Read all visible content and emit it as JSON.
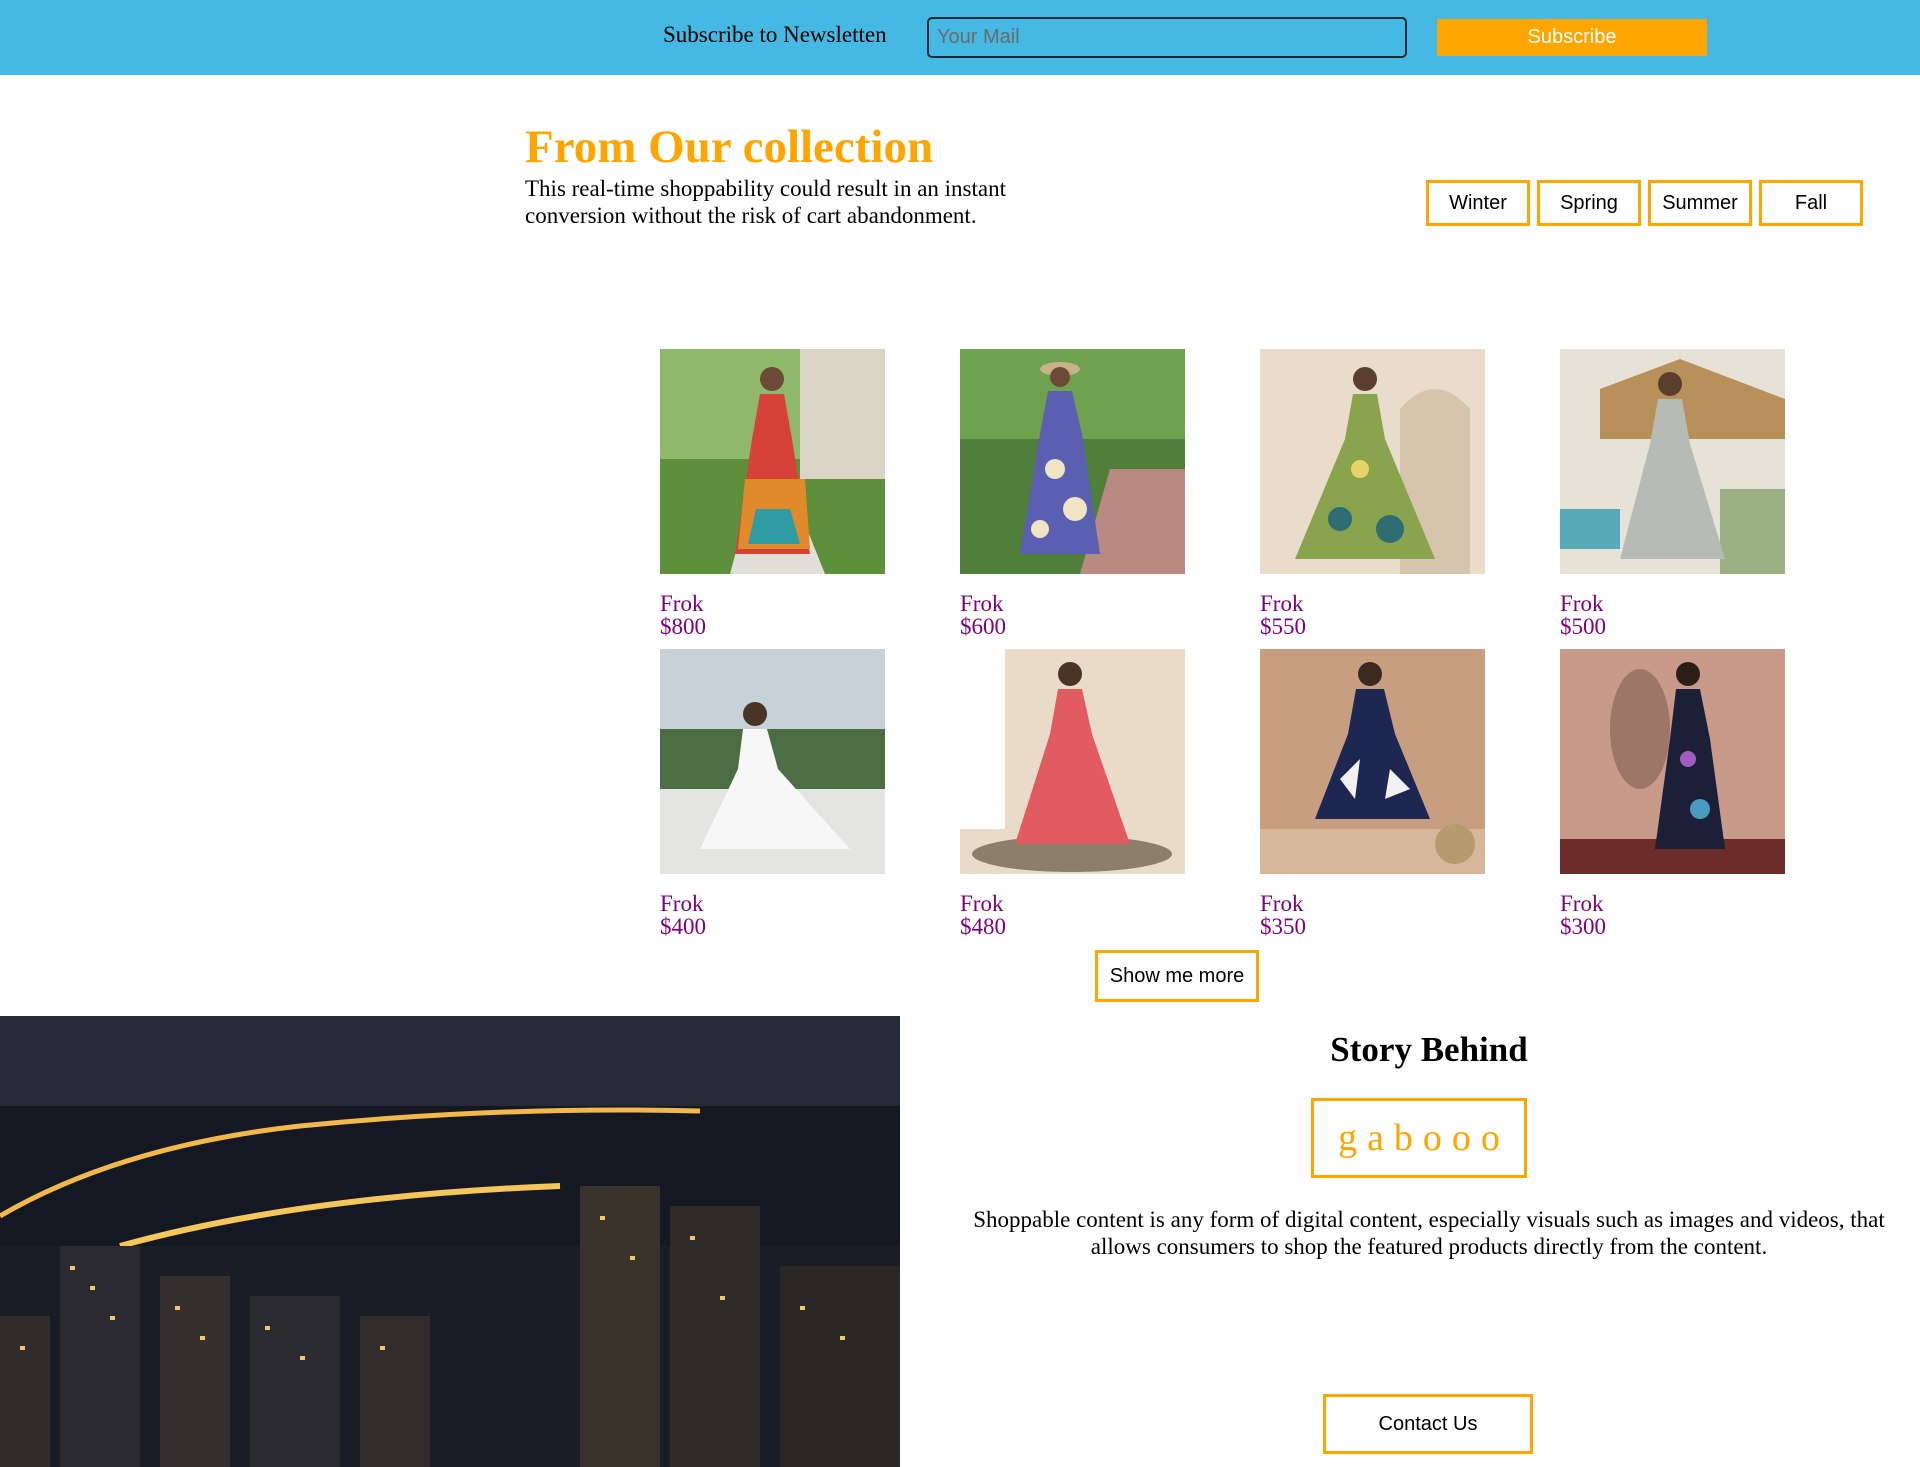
{
  "newsletter": {
    "label": "Subscribe to Newsletten",
    "email_placeholder": "Your Mail",
    "subscribe_label": "Subscribe",
    "bar_color": "#45b8e4",
    "button_color": "#ffa500"
  },
  "collection": {
    "title": "From Our collection",
    "description": "This real-time shoppability could result in an instant conversion without the risk of cart abandonment.",
    "tabs": [
      "Winter",
      "Spring",
      "Summer",
      "Fall"
    ],
    "accent_color": "#ffa500"
  },
  "products": [
    {
      "name": "Frok",
      "price": "$800",
      "photo": "model in multicolour floral maxi dress outdoors"
    },
    {
      "name": "Frok",
      "price": "$600",
      "photo": "model in blue floral dress with sun hat in garden"
    },
    {
      "name": "Frok",
      "price": "$550",
      "photo": "model in green floral flared dress"
    },
    {
      "name": "Frok",
      "price": "$500",
      "photo": "model in grey printed tiered dress by pool"
    },
    {
      "name": "Frok",
      "price": "$400",
      "photo": "model in white flared gown on terrace"
    },
    {
      "name": "Frok",
      "price": "$480",
      "photo": "model in red printed dress indoors"
    },
    {
      "name": "Frok",
      "price": "$350",
      "photo": "model in navy printed dress"
    },
    {
      "name": "Frok",
      "price": "$300",
      "photo": "model in dark floral maxi dress"
    }
  ],
  "show_more_label": "Show me more",
  "story": {
    "title": "Story Behind",
    "brand": "gabooo",
    "text": "Shoppable content is any form of digital content, especially visuals such as images and videos, that allows consumers to shop the featured products directly from the content.",
    "contact_label": "Contact Us",
    "photo": "night city skyline with lit sea bridge"
  }
}
